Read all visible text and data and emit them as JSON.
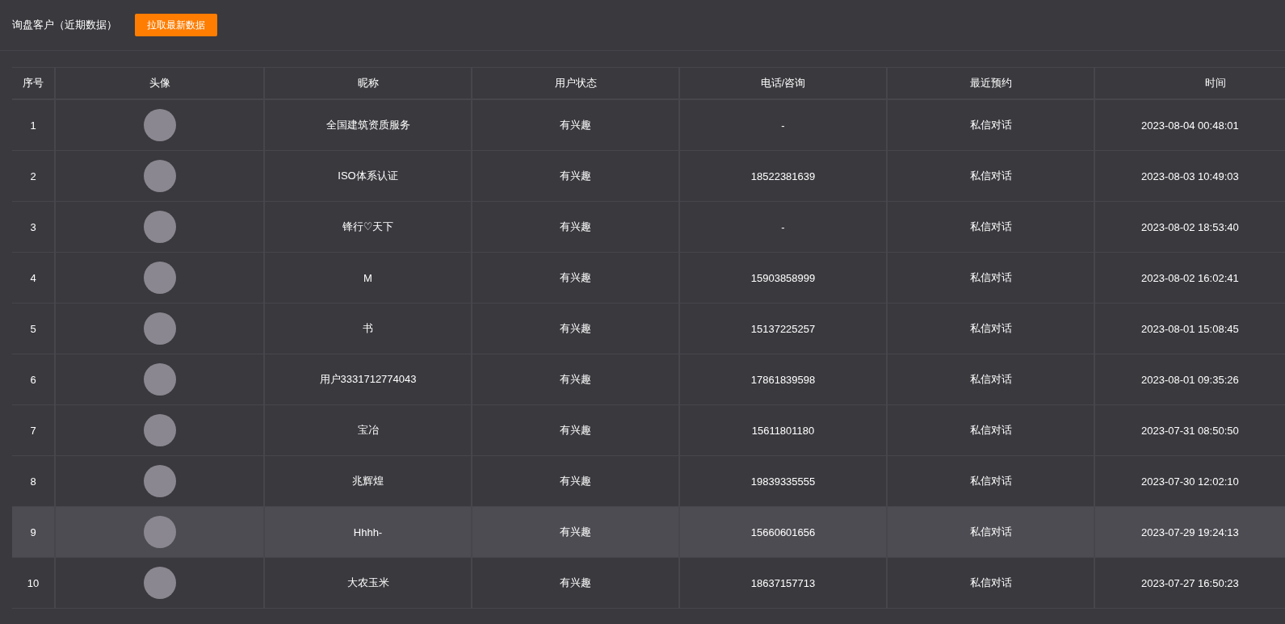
{
  "header": {
    "title": "询盘客户（近期数据）",
    "button": "拉取最新数据"
  },
  "table": {
    "columns": [
      "序号",
      "头像",
      "昵称",
      "用户状态",
      "电话/咨询",
      "最近预约",
      "时间"
    ],
    "rows": [
      {
        "index": "1",
        "nickname": "全国建筑资质服务",
        "status": "有兴趣",
        "phone": "-",
        "booking": "私信对话",
        "time": "2023-08-04 00:48:01",
        "selected": false
      },
      {
        "index": "2",
        "nickname": "ISO体系认证",
        "status": "有兴趣",
        "phone": "18522381639",
        "booking": "私信对话",
        "time": "2023-08-03 10:49:03",
        "selected": false
      },
      {
        "index": "3",
        "nickname": "锋行♡天下",
        "status": "有兴趣",
        "phone": "-",
        "booking": "私信对话",
        "time": "2023-08-02 18:53:40",
        "selected": false
      },
      {
        "index": "4",
        "nickname": "M",
        "status": "有兴趣",
        "phone": "15903858999",
        "booking": "私信对话",
        "time": "2023-08-02 16:02:41",
        "selected": false
      },
      {
        "index": "5",
        "nickname": "书",
        "status": "有兴趣",
        "phone": "15137225257",
        "booking": "私信对话",
        "time": "2023-08-01 15:08:45",
        "selected": false
      },
      {
        "index": "6",
        "nickname": "用户3331712774043",
        "status": "有兴趣",
        "phone": "17861839598",
        "booking": "私信对话",
        "time": "2023-08-01 09:35:26",
        "selected": false
      },
      {
        "index": "7",
        "nickname": "宝冶",
        "status": "有兴趣",
        "phone": "15611801180",
        "booking": "私信对话",
        "time": "2023-07-31 08:50:50",
        "selected": false
      },
      {
        "index": "8",
        "nickname": "兆辉煌",
        "status": "有兴趣",
        "phone": "19839335555",
        "booking": "私信对话",
        "time": "2023-07-30 12:02:10",
        "selected": false
      },
      {
        "index": "9",
        "nickname": "Hhhh-",
        "status": "有兴趣",
        "phone": "15660601656",
        "booking": "私信对话",
        "time": "2023-07-29 19:24:13",
        "selected": true
      },
      {
        "index": "10",
        "nickname": "大农玉米",
        "status": "有兴趣",
        "phone": "18637157713",
        "booking": "私信对话",
        "time": "2023-07-27 16:50:23",
        "selected": false
      }
    ]
  }
}
